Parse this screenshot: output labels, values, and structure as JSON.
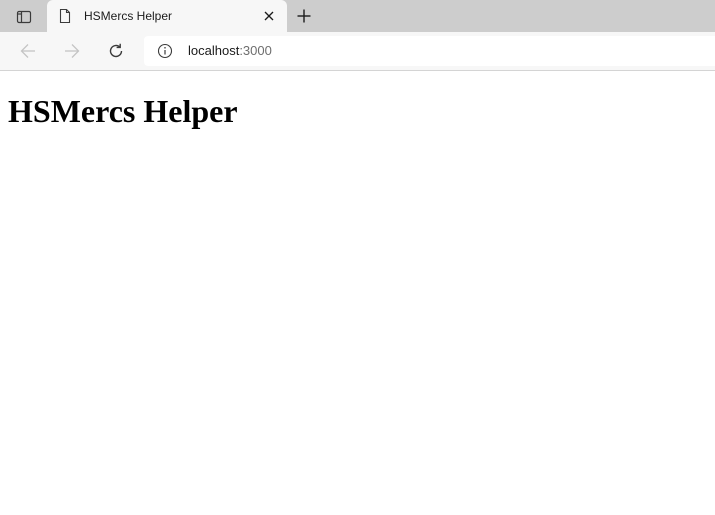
{
  "browser": {
    "tab": {
      "title": "HSMercs Helper",
      "favicon_icon": "page-icon",
      "close_icon": "close-icon"
    },
    "tab_actions_icon": "tab-actions-icon",
    "new_tab_icon": "plus-icon",
    "nav": {
      "back_icon": "arrow-left-icon",
      "forward_icon": "arrow-right-icon",
      "reload_icon": "reload-icon"
    },
    "address_bar": {
      "info_icon": "info-icon",
      "url_host": "localhost",
      "url_port": ":3000"
    }
  },
  "page": {
    "heading": "HSMercs Helper"
  },
  "colors": {
    "tabstrip_bg": "#cdcdcd",
    "toolbar_bg": "#f7f7f7",
    "page_bg": "#ffffff",
    "icon_active": "#3b3b3b",
    "icon_disabled": "#c4c4c4"
  }
}
